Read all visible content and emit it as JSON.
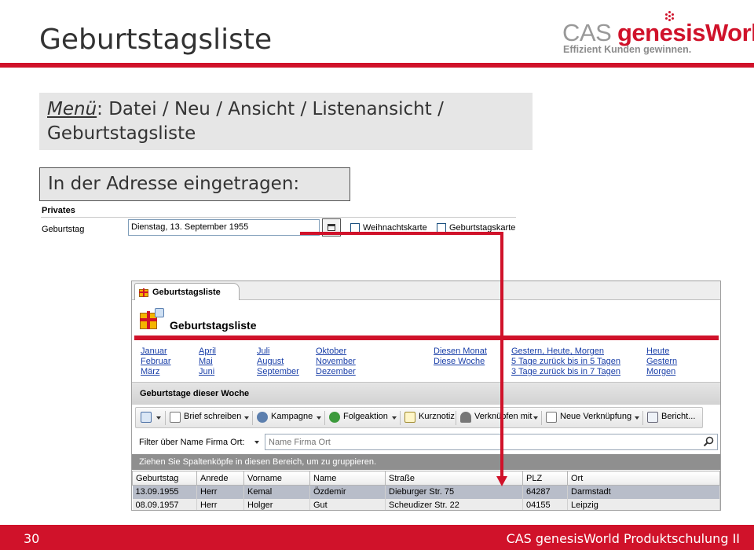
{
  "slide": {
    "title": "Geburtstagsliste",
    "brand_cas": "CAS",
    "brand_genesis": "genesisWorld",
    "brand_tagline": "Effizient Kunden gewinnen.",
    "menu_prefix": "Menü",
    "menu_path": ": Datei / Neu / Ansicht / Listenansicht / Geburtstagsliste",
    "address_label": "In der Adresse eingetragen:",
    "page_number": "30",
    "footer_text": "CAS genesisWorld Produktschulung II",
    "accent_color": "#d0122a"
  },
  "address_snippet": {
    "section": "Privates",
    "field_label": "Geburtstag",
    "field_value": "Dienstag, 13. September 1955",
    "checkbox_1": "Weihnachtskarte",
    "checkbox_2": "Geburtstagskarte"
  },
  "app": {
    "tab_label": "Geburtstagsliste",
    "header_title": "Geburtstagsliste",
    "links": {
      "col1": [
        "Januar",
        "Februar",
        "März"
      ],
      "col2": [
        "April",
        "Mai",
        "Juni"
      ],
      "col3": [
        "Juli",
        "August",
        "September"
      ],
      "col4": [
        "Oktober",
        "November",
        "Dezember"
      ],
      "col5": [
        "Diesen Monat",
        "Diese Woche"
      ],
      "col6": [
        "Gestern, Heute, Morgen",
        "5 Tage zurück bis in 5 Tagen",
        "3 Tage zurück bis in 7 Tagen"
      ],
      "col7": [
        "Heute",
        "Gestern",
        "Morgen"
      ]
    },
    "section_title": "Geburtstage dieser Woche",
    "toolbar": {
      "brief": "Brief schreiben",
      "kampagne": "Kampagne",
      "folgeaktion": "Folgeaktion",
      "kurznotiz": "Kurznotiz",
      "verknuepfen": "Verknüpfen mit",
      "neue_verknuepfung": "Neue Verknüpfung",
      "bericht": "Bericht..."
    },
    "filter_label": "Filter über Name Firma Ort:",
    "filter_placeholder": "Name Firma Ort",
    "group_hint": "Ziehen Sie Spaltenköpfe in diesen Bereich, um zu gruppieren.",
    "columns": [
      "Geburtstag",
      "Anrede",
      "Vorname",
      "Name",
      "Straße",
      "PLZ",
      "Ort"
    ],
    "rows": [
      [
        "13.09.1955",
        "Herr",
        "Kemal",
        "Özdemir",
        "Dieburger Str. 75",
        "64287",
        "Darmstadt"
      ],
      [
        "08.09.1957",
        "Herr",
        "Holger",
        "Gut",
        "Scheudizer Str. 22",
        "04155",
        "Leipzig"
      ]
    ]
  }
}
